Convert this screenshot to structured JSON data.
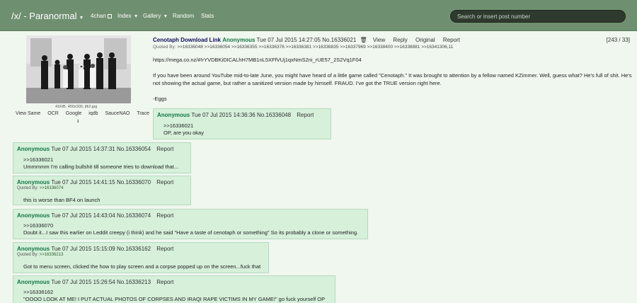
{
  "header": {
    "board_title": "/x/ - Paranormal",
    "nav": [
      "4chan",
      "Index",
      "Gallery",
      "Random",
      "Stats"
    ],
    "search_placeholder": "Search or insert post number"
  },
  "op": {
    "file_info": "41KiB, 450x300, jfk2.jpg",
    "image_links": [
      "View Same",
      "OCR",
      "Google",
      "iqdb",
      "SauceNAO",
      "Trace"
    ],
    "subject": "Cenotaph Download Link",
    "name": "Anonymous",
    "datetime": "Tue 07 Jul 2015 14:27:05",
    "number": "No.16336021",
    "buttons": [
      "View",
      "Reply",
      "Original",
      "Report"
    ],
    "count": "[243 / 33]",
    "quoted_by_label": "Quoted By:",
    "quoted_by": ">>16336048 >>16336054 >>16336355 >>16336376 >>16336381 >>16336835 >>16337969 >>16338400 >>16338881 >>16341306,11",
    "link": "https://mega.co.nz/#!rYVDBKiDICALhH7MB1nL5XFfVUj1qxNmS2ni_rUE57_2S2Vq1F04",
    "paragraph": "If you have been around YouTube mid-to-late June, you might have heard of a little game called \"Cenotaph.\" It was brought to attention by a fellow named KZimmer. Well, guess what? He's full of shit. He's not showing the actual game, but rather a sanitized version made by himself. FRAUD. I've got the TRUE version right here.",
    "signature": "-Eggs"
  },
  "replies": [
    {
      "name": "Anonymous",
      "datetime": "Tue 07 Jul 2015 14:36:36",
      "number": "No.16336048",
      "report": "Report",
      "quote": ">>16336021",
      "text": "OP, are you okay"
    },
    {
      "name": "Anonymous",
      "datetime": "Tue 07 Jul 2015 14:37:31",
      "number": "No.16336054",
      "report": "Report",
      "quote": ">>16336021",
      "text": "Ummmmm I'm calling bullshit till someone tries to download that..."
    },
    {
      "name": "Anonymous",
      "datetime": "Tue 07 Jul 2015 14:41:15",
      "number": "No.16336070",
      "report": "Report",
      "quoted_by_label": "Quoted By:",
      "quoted_by": ">>16336074",
      "text": "this is worse than BF4 on launch"
    },
    {
      "name": "Anonymous",
      "datetime": "Tue 07 Jul 2015 14:43:04",
      "number": "No.16336074",
      "report": "Report",
      "quote": ">>16336070",
      "text": "Doubt it...I saw this earlier on Leddit creepy (i think) and he said \"Have a taste of cenotaph or something\" So its probably a clone or something."
    },
    {
      "name": "Anonymous",
      "datetime": "Tue 07 Jul 2015 15:15:09",
      "number": "No.16336162",
      "report": "Report",
      "quoted_by_label": "Quoted By:",
      "quoted_by": ">>16336213",
      "text": "Got to menu screen, clicked the how to play screen and a corpse popped up on the screen...fuck that"
    },
    {
      "name": "Anonymous",
      "datetime": "Tue 07 Jul 2015 15:26:54",
      "number": "No.16336213",
      "report": "Report",
      "quote": ">>16336162",
      "text": "\"OOOO LOOK AT ME! I PUT ACTUAL PHOTOS OF CORPSES AND IRAQI RAPE VICTIMS IN MY GAME!\" go fuck yourself OP"
    }
  ]
}
